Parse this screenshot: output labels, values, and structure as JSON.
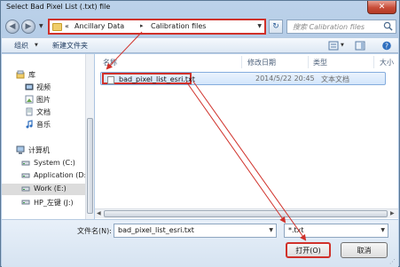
{
  "window": {
    "title": "Select Bad Pixel List (.txt) file",
    "close_glyph": "✕"
  },
  "address": {
    "prefix": "«",
    "crumbs": [
      "Ancillary Data",
      "Calibration files"
    ],
    "separator": "▸",
    "search_placeholder": "搜索 Calibration files"
  },
  "toolbar": {
    "organize": "组织",
    "new_folder": "新建文件夹"
  },
  "sidebar": {
    "items": [
      {
        "label": "库",
        "icon": "library-icon",
        "indent": false
      },
      {
        "label": "视频",
        "icon": "video-icon",
        "indent": true
      },
      {
        "label": "图片",
        "icon": "picture-icon",
        "indent": true
      },
      {
        "label": "文档",
        "icon": "document-icon",
        "indent": true
      },
      {
        "label": "音乐",
        "icon": "music-icon",
        "indent": true
      },
      {
        "label": "计算机",
        "icon": "computer-icon",
        "indent": false
      },
      {
        "label": "System (C:)",
        "icon": "drive-icon",
        "indent": true
      },
      {
        "label": "Application (D:)",
        "icon": "drive-icon",
        "indent": true
      },
      {
        "label": "Work (E:)",
        "icon": "drive-icon",
        "indent": true,
        "selected": true
      },
      {
        "label": "HP_左键 (J:)",
        "icon": "drive-icon",
        "indent": true
      }
    ]
  },
  "file_list": {
    "columns": [
      "名称",
      "修改日期",
      "类型",
      "大小"
    ],
    "files": [
      {
        "name": "bad_pixel_list_esri.txt",
        "modified": "2014/5/22 20:45",
        "type": "文本文档"
      }
    ]
  },
  "footer": {
    "filename_label": "文件名(N):",
    "filename_value": "bad_pixel_list_esri.txt",
    "filter_value": "*.txt",
    "open_label": "打开(O)",
    "cancel_label": "取消"
  },
  "colors": {
    "highlight": "#d0312a",
    "selection": "#d3e6fb"
  }
}
